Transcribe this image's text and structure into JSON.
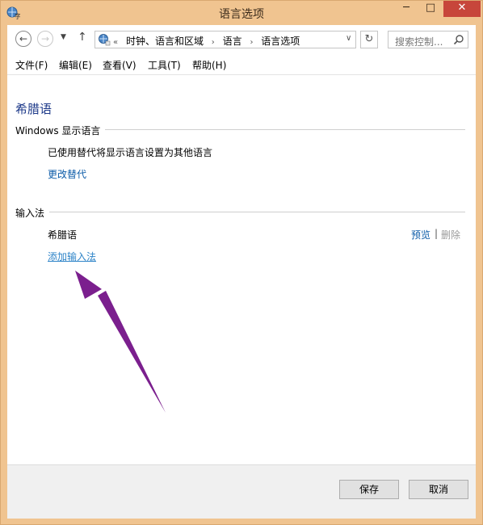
{
  "window": {
    "title": "语言选项",
    "min_glyph": "─",
    "max_glyph": "□",
    "close_glyph": "✕"
  },
  "address_bar": {
    "back_glyph": "←",
    "forward_glyph": "→",
    "recent_glyph": "▼",
    "up_glyph": "↑",
    "overflow": "«",
    "breadcrumbs": [
      "时钟、语言和区域",
      "语言",
      "语言选项"
    ],
    "separator": "›",
    "dropdown_glyph": "∨",
    "refresh_glyph": "↻",
    "search_placeholder": "搜索控制..."
  },
  "menu": {
    "file": "文件(F)",
    "edit": "编辑(E)",
    "view": "查看(V)",
    "tools": "工具(T)",
    "help": "帮助(H)"
  },
  "main": {
    "heading": "希腊语",
    "display_section": {
      "label": "Windows 显示语言",
      "description": "已使用替代将显示语言设置为其他语言",
      "change_link": "更改替代"
    },
    "ime_section": {
      "label": "输入法",
      "ime_name": "希腊语",
      "preview_link": "预览",
      "divider": "|",
      "remove_link": "删除",
      "add_link": "添加输入法"
    }
  },
  "footer": {
    "save": "保存",
    "cancel": "取消"
  },
  "colors": {
    "titlebar": "#f0c490",
    "close": "#c7463b",
    "link": "#0b5ba8",
    "heading": "#1e3a8a",
    "annotation_arrow": "#7b1f8e"
  }
}
